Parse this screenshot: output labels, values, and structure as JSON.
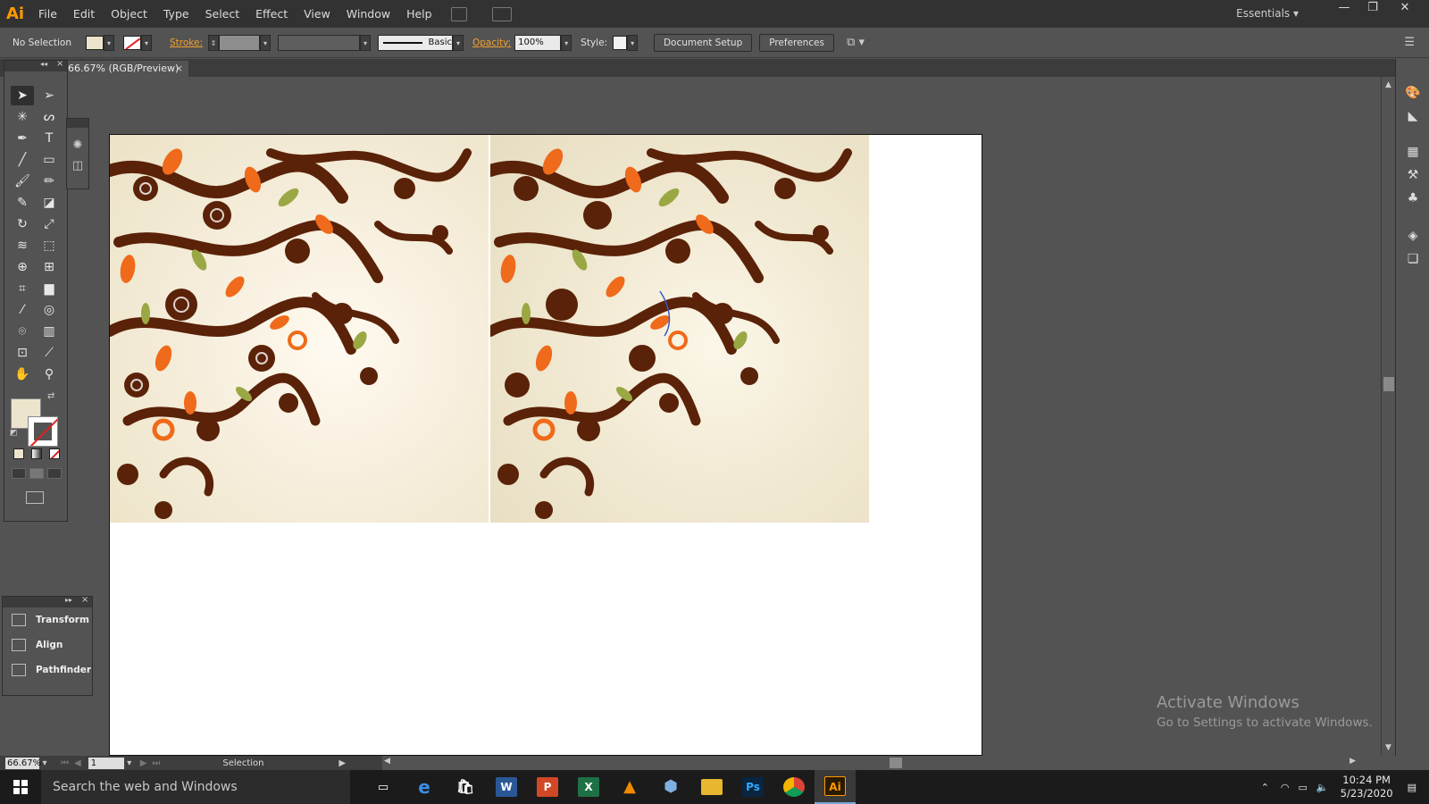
{
  "app": {
    "logo": "Ai",
    "workspace": "Essentials ▾"
  },
  "menu": [
    "File",
    "Edit",
    "Object",
    "Type",
    "Select",
    "Effect",
    "View",
    "Window",
    "Help"
  ],
  "control_bar": {
    "selection_state": "No Selection",
    "stroke_label": "Stroke:",
    "brush_label": "Basic",
    "opacity_label": "Opacity:",
    "opacity_value": "100%",
    "style_label": "Style:",
    "document_setup": "Document Setup",
    "preferences": "Preferences"
  },
  "document_tab": {
    "title": "66.67% (RGB/Preview)",
    "close": "×"
  },
  "tools_panel": {
    "collapse": "◂◂",
    "close": "×"
  },
  "side_panel": {
    "items": [
      "Transform",
      "Align",
      "Pathfinder"
    ]
  },
  "status": {
    "zoom": "66.67%",
    "artboard_number": "1",
    "tool": "Selection"
  },
  "watermark": {
    "title": "Activate Windows",
    "subtitle": "Go to Settings to activate Windows."
  },
  "taskbar": {
    "search_placeholder": "Search the web and Windows",
    "time": "10:24 PM",
    "date": "5/23/2020"
  },
  "colors": {
    "accent": "#ff9a00",
    "fill": "#ece4cc",
    "art_brown": "#5a2208",
    "art_orange": "#ef6a1a",
    "art_green": "#9aa844"
  },
  "icons": [
    "selection-tool",
    "direct-selection-tool",
    "magic-wand",
    "lasso",
    "pen",
    "type",
    "line",
    "rectangle",
    "paintbrush",
    "pencil",
    "blob-brush",
    "eraser",
    "rotate",
    "scale",
    "warp",
    "free-transform",
    "shape-builder",
    "perspective-grid",
    "mesh",
    "gradient",
    "eyedropper",
    "blend",
    "symbol-sprayer",
    "column-graph",
    "artboard",
    "slice",
    "hand",
    "zoom"
  ]
}
